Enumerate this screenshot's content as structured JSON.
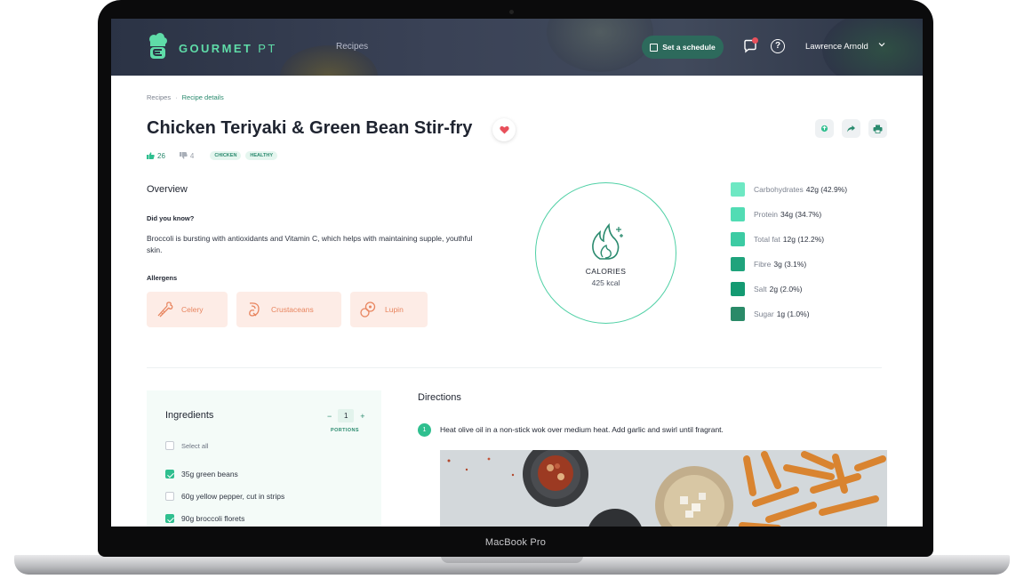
{
  "device": {
    "label": "MacBook Pro"
  },
  "header": {
    "brand_main": "GOURMET",
    "brand_suffix": "PT",
    "nav_recipes": "Recipes",
    "schedule_button": "Set a schedule",
    "user_name": "Lawrence Arnold",
    "icons": [
      "logo-icon",
      "calendar-icon",
      "chat-icon",
      "help-icon",
      "chevron-down-icon"
    ]
  },
  "breadcrumb": {
    "root": "Recipes",
    "separator": "·",
    "current": "Recipe details"
  },
  "recipe": {
    "title": "Chicken Teriyaki & Green Bean Stir-fry",
    "likes": "26",
    "dislikes": "4",
    "tags": [
      "CHICKEN",
      "HEALTHY"
    ],
    "actions": [
      "save-icon",
      "share-icon",
      "print-icon"
    ]
  },
  "overview": {
    "heading": "Overview",
    "did_you_know_heading": "Did you know?",
    "did_you_know_text": "Broccoli is bursting with antioxidants and Vitamin C, which helps with maintaining supple, youthful skin.",
    "allergens_heading": "Allergens",
    "allergens": [
      {
        "label": "Celery",
        "icon": "celery-icon"
      },
      {
        "label": "Crustaceans",
        "icon": "shrimp-icon"
      },
      {
        "label": "Lupin",
        "icon": "lupin-icon"
      }
    ]
  },
  "calories": {
    "label": "CALORIES",
    "value": "425 kcal"
  },
  "nutrition": [
    {
      "label": "Carbohydrates",
      "value": "42g (42.9%)",
      "color": "#6ee8c3"
    },
    {
      "label": "Protein",
      "value": "34g (34.7%)",
      "color": "#52dcb4"
    },
    {
      "label": "Total fat",
      "value": "12g (12.2%)",
      "color": "#3ccba3"
    },
    {
      "label": "Fibre",
      "value": "3g (3.1%)",
      "color": "#1fa37c"
    },
    {
      "label": "Salt",
      "value": "2g (2.0%)",
      "color": "#149a72"
    },
    {
      "label": "Sugar",
      "value": "1g (1.0%)",
      "color": "#2a8a68"
    }
  ],
  "ingredients": {
    "heading": "Ingredients",
    "portions_value": "1",
    "portions_label": "PORTIONS",
    "minus": "−",
    "plus": "+",
    "select_all": "Select all",
    "items": [
      {
        "label": "35g green beans",
        "checked": true
      },
      {
        "label": "60g yellow pepper, cut in strips",
        "checked": false
      },
      {
        "label": "90g broccoli florets",
        "checked": true
      }
    ]
  },
  "directions": {
    "heading": "Directions",
    "steps": [
      {
        "number": "1",
        "text": "Heat olive oil in a non-stick wok over medium heat. Add garlic and swirl until fragrant."
      }
    ]
  },
  "colors": {
    "accent": "#2fbf8f",
    "brand": "#5fdca8",
    "allergen_bg": "#fdece6",
    "allergen_fg": "#e8855f"
  }
}
